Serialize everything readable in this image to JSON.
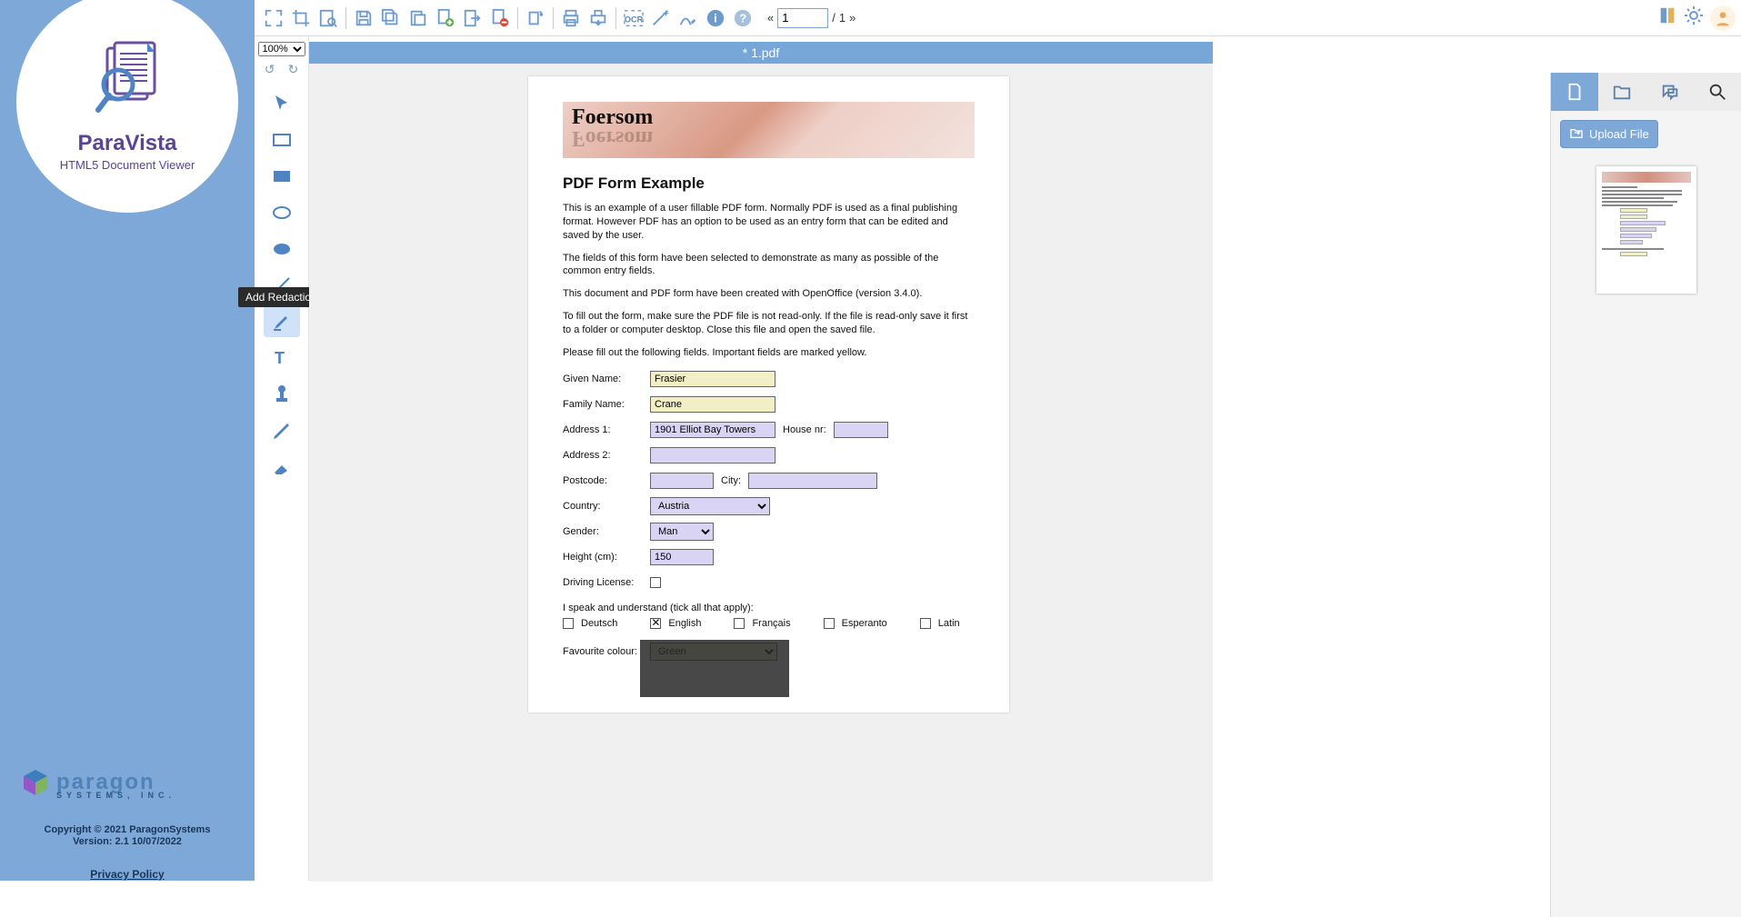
{
  "brand": {
    "title": "ParaVista",
    "subtitle": "HTML5 Document Viewer"
  },
  "footer": {
    "company": "paragon",
    "company_sub": "SYSTEMS, INC.",
    "copyright": "Copyright © 2021 ParagonSystems",
    "version": "Version: 2.1 10/07/2022",
    "privacy": "Privacy Policy"
  },
  "pageNav": {
    "prev": "«",
    "current": "1",
    "total": "1",
    "next": "»",
    "sep": "/"
  },
  "zoom": {
    "value": "100%"
  },
  "tooltip": "Add Redaction",
  "doc": {
    "title": "* 1.pdf",
    "logo": "Foersom",
    "h1": "PDF Form Example",
    "p1": "This is an example of a user fillable PDF form. Normally PDF is used as a final publishing format. However PDF has an option to be used as an entry form that can be edited and saved by the user.",
    "p2": "The fields of this form have been selected to demonstrate as many as possible of the common entry fields.",
    "p3": "This document and PDF form have been created with OpenOffice (version 3.4.0).",
    "p4": "To fill out the form, make sure the PDF file is not read-only. If the file is read-only save it first to a folder or computer desktop. Close this file and open the saved file.",
    "p5": "Please fill out the following fields. Important fields are marked yellow.",
    "labels": {
      "givenName": "Given Name:",
      "familyName": "Family Name:",
      "address1": "Address 1:",
      "address2": "Address 2:",
      "houseNr": "House nr:",
      "postcode": "Postcode:",
      "city": "City:",
      "country": "Country:",
      "gender": "Gender:",
      "height": "Height (cm):",
      "driving": "Driving License:",
      "speak": "I speak and understand (tick all that apply):",
      "favColour": "Favourite colour:"
    },
    "values": {
      "givenName": "Frasier",
      "familyName": "Crane",
      "address1": "1901 Elliot Bay Towers",
      "address2": "",
      "houseNr": "",
      "postcode": "",
      "city": "",
      "country": "Austria",
      "gender": "Man",
      "height": "150",
      "favColour": "Green"
    },
    "langs": [
      "Deutsch",
      "English",
      "Français",
      "Esperanto",
      "Latin"
    ],
    "langChecked": "English"
  },
  "rightPanel": {
    "upload": "Upload File"
  }
}
